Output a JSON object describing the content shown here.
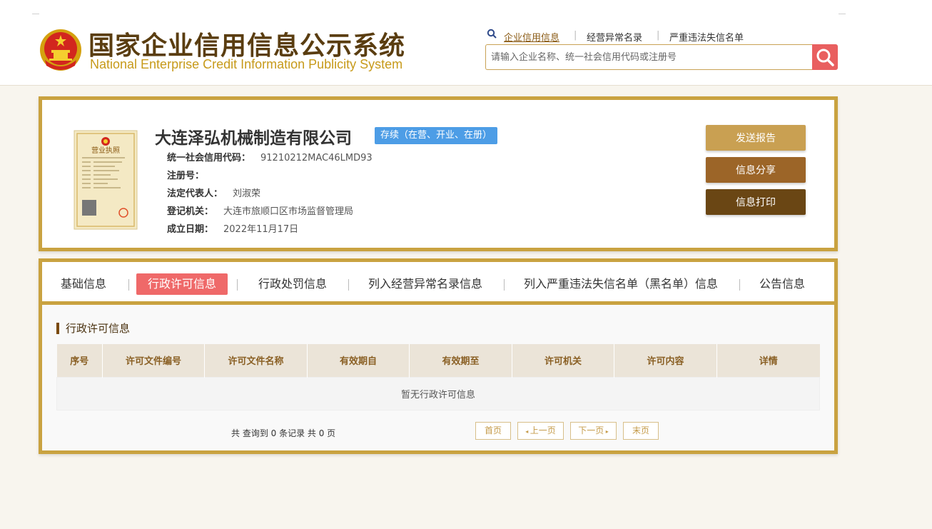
{
  "header": {
    "title_cn": "国家企业信用信息公示系统",
    "title_en": "National Enterprise Credit Information Publicity System",
    "links": [
      "企业信用信息",
      "经营异常名录",
      "严重违法失信名单"
    ],
    "separator": "|",
    "search": {
      "placeholder": "请输入企业名称、统一社会信用代码或注册号"
    }
  },
  "company": {
    "name": "大连泽弘机械制造有限公司",
    "status": "存续（在营、开业、在册）",
    "license_image_text": "营业执照",
    "fields": [
      {
        "label": "统一社会信用代码：",
        "value": "91210212MAC46LMD93"
      },
      {
        "label": "注册号：",
        "value": ""
      },
      {
        "label": "法定代表人：",
        "value": "刘淑荣"
      },
      {
        "label": "登记机关：",
        "value": "大连市旅顺口区市场监督管理局"
      },
      {
        "label": "成立日期：",
        "value": "2022年11月17日"
      }
    ],
    "actions": {
      "send_report": "发送报告",
      "share": "信息分享",
      "print": "信息打印"
    }
  },
  "tabs": [
    "基础信息",
    "行政许可信息",
    "行政处罚信息",
    "列入经营异常名录信息",
    "列入严重违法失信名单（黑名单）信息",
    "公告信息"
  ],
  "active_tab": "行政许可信息",
  "section": {
    "title": "行政许可信息",
    "columns": [
      "序号",
      "许可文件编号",
      "许可文件名称",
      "有效期自",
      "有效期至",
      "许可机关",
      "许可内容",
      "详情"
    ],
    "empty_message": "暂无行政许可信息"
  },
  "pager": {
    "summary": "共 查询到 0 条记录 共 0 页",
    "first": "首页",
    "prev": "上一页",
    "next": "下一页",
    "last": "末页"
  },
  "colors": {
    "gold_border": "#c9a240",
    "active_tab": "#ef6969",
    "status_badge": "#4d9de6",
    "btn_send": "#c9a052",
    "btn_share": "#9c6528",
    "btn_print": "#6a4614"
  }
}
